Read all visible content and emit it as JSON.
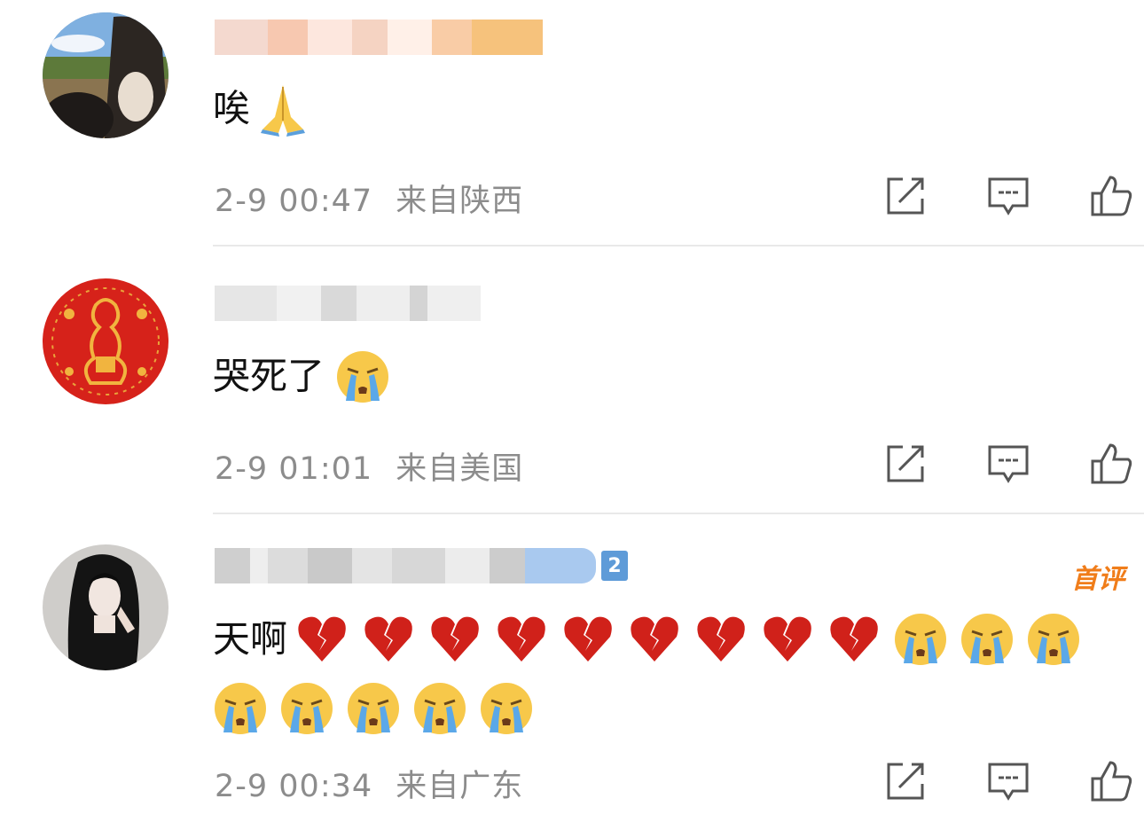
{
  "comments": [
    {
      "content": "唉",
      "time": "2-9 00:47",
      "location": "来自陕西",
      "emojis": [
        "pray-emoji"
      ]
    },
    {
      "content": "哭死了",
      "time": "2-9 01:01",
      "location": "来自美国",
      "emojis": [
        "crying-emoji"
      ]
    },
    {
      "content": "天啊",
      "time": "2-9 00:34",
      "location": "来自广东",
      "badge": "首评",
      "level": "2",
      "emojis": [
        "broken-heart-emoji",
        "broken-heart-emoji",
        "broken-heart-emoji",
        "broken-heart-emoji",
        "broken-heart-emoji",
        "broken-heart-emoji",
        "broken-heart-emoji",
        "broken-heart-emoji",
        "broken-heart-emoji",
        "crying-emoji",
        "crying-emoji",
        "crying-emoji",
        "crying-emoji",
        "crying-emoji",
        "crying-emoji",
        "crying-emoji",
        "crying-emoji"
      ]
    }
  ],
  "icons": {
    "share": "share-icon",
    "comment": "comment-icon",
    "like": "thumbs-up-icon"
  },
  "colors": {
    "meta_text": "#8c8c8c",
    "badge": "#f07d1a",
    "level_badge": "#5e9bd8",
    "divider": "#e9e9e9"
  }
}
